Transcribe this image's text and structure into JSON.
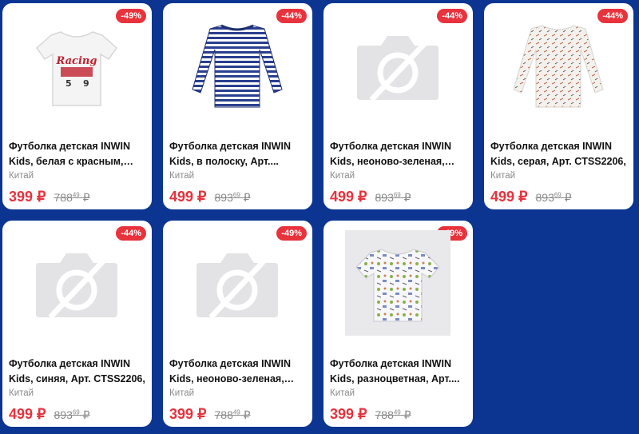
{
  "colors": {
    "background": "#0c3592",
    "accent": "#e8323c",
    "muted": "#8a8a8a"
  },
  "products": [
    {
      "badge": "-49%",
      "image": "tshirt-white-print",
      "title": "Футболка детская INWIN Kids, белая с красным, Арт....",
      "origin": "Китай",
      "price": "399 ₽",
      "old_int": "788",
      "old_frac": "49",
      "old_cur": "₽"
    },
    {
      "badge": "-44%",
      "image": "longsleeve-striped",
      "title": "Футболка детская INWIN Kids, в полоску, Арт....",
      "origin": "Китай",
      "price": "499 ₽",
      "old_int": "893",
      "old_frac": "69",
      "old_cur": "₽"
    },
    {
      "badge": "-44%",
      "image": "placeholder",
      "title": "Футболка детская INWIN Kids, неоново-зеленая, Арт....",
      "origin": "Китай",
      "price": "499 ₽",
      "old_int": "893",
      "old_frac": "69",
      "old_cur": "₽"
    },
    {
      "badge": "-44%",
      "image": "longsleeve-gray-pattern",
      "title": "Футболка детская INWIN Kids, серая, Арт. CTSS2206,",
      "origin": "Китай",
      "price": "499 ₽",
      "old_int": "893",
      "old_frac": "69",
      "old_cur": "₽"
    },
    {
      "badge": "-44%",
      "image": "placeholder",
      "title": "Футболка детская INWIN Kids, синяя, Арт. CTSS2206,",
      "origin": "Китай",
      "price": "499 ₽",
      "old_int": "893",
      "old_frac": "69",
      "old_cur": "₽"
    },
    {
      "badge": "-49%",
      "image": "placeholder",
      "title": "Футболка детская INWIN Kids, неоново-зеленая, Арт....",
      "origin": "Китай",
      "price": "399 ₽",
      "old_int": "788",
      "old_frac": "49",
      "old_cur": "₽"
    },
    {
      "badge": "-49%",
      "image": "tshirt-multicolor-print",
      "title": "Футболка детская INWIN Kids, разноцветная, Арт....",
      "origin": "Китай",
      "price": "399 ₽",
      "old_int": "788",
      "old_frac": "49",
      "old_cur": "₽"
    }
  ]
}
